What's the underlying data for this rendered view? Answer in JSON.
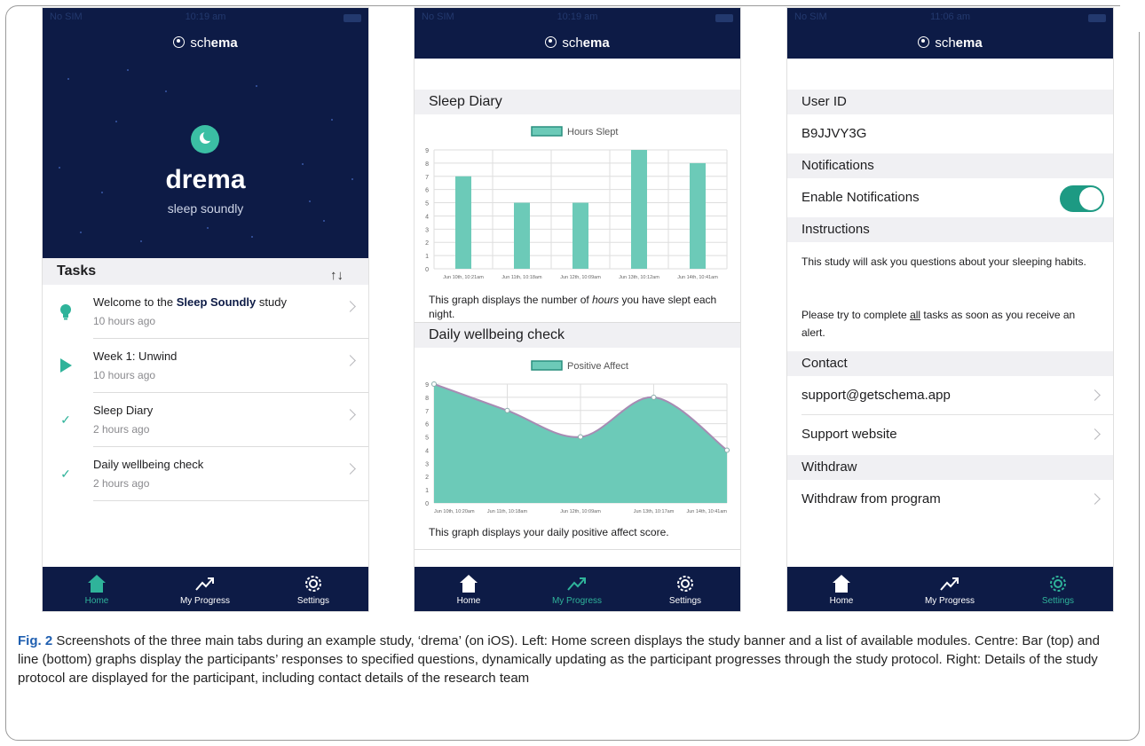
{
  "colors": {
    "navy": "#0d1b46",
    "teal": "#2fb39a",
    "chart_fill": "#6ccab8",
    "area_line": "#a78bb3"
  },
  "app": {
    "logo_prefix": "sch",
    "logo_bold": "ema",
    "logo_icon": "schema-logo-icon"
  },
  "phones": [
    {
      "carrier": "No SIM",
      "time": "10:19 am"
    },
    {
      "carrier": "No SIM",
      "time": "10:19 am"
    },
    {
      "carrier": "No SIM",
      "time": "11:06 am"
    }
  ],
  "tabs": [
    {
      "label": "Home",
      "icon": "house-icon"
    },
    {
      "label": "My Progress",
      "icon": "trend-icon"
    },
    {
      "label": "Settings",
      "icon": "gear-icon"
    }
  ],
  "home": {
    "banner_title": "drema",
    "banner_subtitle": "sleep soundly",
    "tasks_header": "Tasks",
    "tasks": [
      {
        "icon": "lightbulb-icon",
        "title_pre": "Welcome to the ",
        "title_bold": "Sleep Soundly",
        "title_post": " study",
        "time": "10 hours ago"
      },
      {
        "icon": "play-icon",
        "title_pre": "Week 1: Unwind",
        "title_bold": "",
        "title_post": "",
        "time": "10 hours ago"
      },
      {
        "icon": "check-icon",
        "title_pre": "Sleep Diary",
        "title_bold": "",
        "title_post": "",
        "time": "2 hours ago"
      },
      {
        "icon": "check-icon",
        "title_pre": "Daily wellbeing check",
        "title_bold": "",
        "title_post": "",
        "time": "2 hours ago"
      }
    ]
  },
  "progress": {
    "sleep_header": "Sleep Diary",
    "sleep_caption_pre": "This graph displays the number of ",
    "sleep_caption_em": "hours",
    "sleep_caption_post": " you have slept each night.",
    "wellbeing_header": "Daily wellbeing check",
    "wellbeing_caption": "This graph displays your daily positive affect score."
  },
  "chart_data": [
    {
      "type": "bar",
      "series": [
        {
          "name": "Hours Slept",
          "values": [
            7,
            5,
            5,
            9,
            8
          ]
        }
      ],
      "categories": [
        "Jun 10th, 10:21am",
        "Jun 11th, 10:18am",
        "Jun 12th, 10:09am",
        "Jun 13th, 10:12am",
        "Jun 14th, 10:41am"
      ],
      "ylim": [
        0,
        9
      ],
      "yticks": [
        0,
        1,
        2,
        3,
        4,
        5,
        6,
        7,
        8,
        9
      ],
      "grid": true,
      "legend": "top"
    },
    {
      "type": "area",
      "series": [
        {
          "name": "Positive Affect",
          "values": [
            9,
            7,
            5,
            8,
            4
          ]
        }
      ],
      "categories": [
        "Jun 10th, 10:20am",
        "Jun 11th, 10:18am",
        "Jun 12th, 10:09am",
        "Jun 13th, 10:17am",
        "Jun 14th, 10:41am"
      ],
      "ylim": [
        0,
        9
      ],
      "yticks": [
        0,
        1,
        2,
        3,
        4,
        5,
        6,
        7,
        8,
        9
      ],
      "grid": true,
      "legend": "top"
    }
  ],
  "settings": {
    "user_id_header": "User ID",
    "user_id": "B9JJVY3G",
    "notifications_header": "Notifications",
    "enable_notifications": "Enable Notifications",
    "notifications_enabled": true,
    "instructions_header": "Instructions",
    "instructions_1": "This study will ask you questions about your sleeping habits.",
    "instructions_2_pre": "Please try to complete ",
    "instructions_2_u": "all",
    "instructions_2_post": " tasks as soon as you receive an alert.",
    "contact_header": "Contact",
    "contact_email": "support@getschema.app",
    "contact_website": "Support website",
    "withdraw_header": "Withdraw",
    "withdraw_item": "Withdraw from program"
  },
  "figure_caption": {
    "label": "Fig. 2",
    "text": " Screenshots of the three main tabs during an example study, ‘drema’ (on iOS). Left: Home screen displays the study banner and a list of available modules. Centre: Bar (top) and line (bottom) graphs display the participants’ responses to specified questions, dynamically updating as the participant progresses through the study protocol. Right: Details of the study protocol are displayed for the participant, including contact details of the research team"
  }
}
